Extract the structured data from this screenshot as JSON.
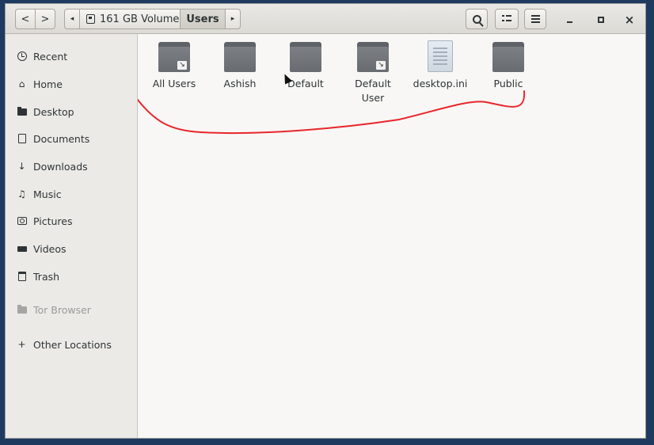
{
  "window": {
    "title": "Users"
  },
  "toolbar": {
    "back_label": "<",
    "forward_label": ">",
    "path_left_label": "◂",
    "path_right_label": "▸",
    "crumbs": [
      "161 GB Volume",
      "Users"
    ],
    "minimize_label": "–",
    "close_label": "×"
  },
  "sidebar": {
    "items": [
      {
        "label": "Recent",
        "icon": "clock-icon"
      },
      {
        "label": "Home",
        "icon": "home-icon"
      },
      {
        "label": "Desktop",
        "icon": "folder-icon"
      },
      {
        "label": "Documents",
        "icon": "document-icon"
      },
      {
        "label": "Downloads",
        "icon": "download-arrow-icon"
      },
      {
        "label": "Music",
        "icon": "music-note-icon"
      },
      {
        "label": "Pictures",
        "icon": "camera-icon"
      },
      {
        "label": "Videos",
        "icon": "video-icon"
      },
      {
        "label": "Trash",
        "icon": "trash-icon"
      },
      {
        "label": "Tor Browser",
        "icon": "folder-icon",
        "disabled": true
      },
      {
        "label": "Other Locations",
        "icon": "plus-icon"
      }
    ]
  },
  "files": [
    {
      "name": "All Users",
      "type": "folder-link"
    },
    {
      "name": "Ashish",
      "type": "folder"
    },
    {
      "name": "Default",
      "type": "folder"
    },
    {
      "name": "Default User",
      "type": "folder-link"
    },
    {
      "name": "desktop.ini",
      "type": "document"
    },
    {
      "name": "Public",
      "type": "folder"
    }
  ],
  "colors": {
    "annotation_stroke": "#e8262b",
    "folder_icon": "#6b6f74",
    "sidebar_bg": "#eceae6"
  }
}
